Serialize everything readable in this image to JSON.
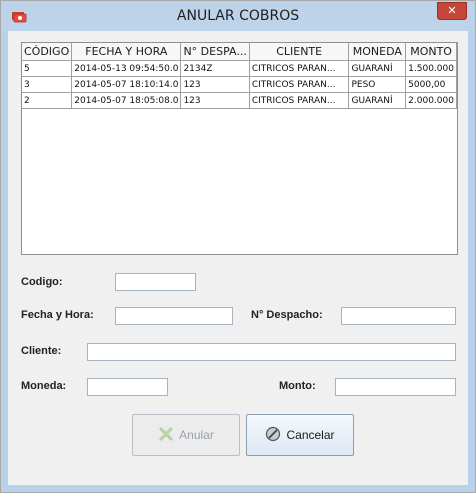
{
  "window": {
    "title": "ANULAR COBROS",
    "close_glyph": "✕"
  },
  "table": {
    "columns": [
      "CÓDIGO",
      "FECHA Y HORA",
      "N° DESPA...",
      "CLIENTE",
      "MONEDA",
      "MONTO"
    ],
    "rows": [
      [
        "5",
        "2014-05-13 09:54:50.0",
        "2134Z",
        "CITRICOS PARAN...",
        "GUARANÍ",
        "1.500.000"
      ],
      [
        "3",
        "2014-05-07 18:10:14.0",
        "123",
        "CITRICOS PARAN...",
        "PESO",
        "5000,00"
      ],
      [
        "2",
        "2014-05-07 18:05:08.0",
        "123",
        "CITRICOS PARAN...",
        "GUARANÍ",
        "2.000.000"
      ]
    ]
  },
  "form": {
    "codigo_label": "Codigo:",
    "codigo_value": "",
    "fecha_label": "Fecha y Hora:",
    "fecha_value": "",
    "despacho_label": "N° Despacho:",
    "despacho_value": "",
    "cliente_label": "Cliente:",
    "cliente_value": "",
    "moneda_label": "Moneda:",
    "moneda_value": "",
    "monto_label": "Monto:",
    "monto_value": ""
  },
  "buttons": {
    "anular_label": "Anular",
    "cancelar_label": "Cancelar",
    "anular_icon": "x-icon",
    "cancelar_icon": "cancel-circle-icon"
  },
  "colors": {
    "title_bar": "#bcd3ea",
    "close_button": "#c7463a",
    "panel": "#f0f0f0"
  }
}
